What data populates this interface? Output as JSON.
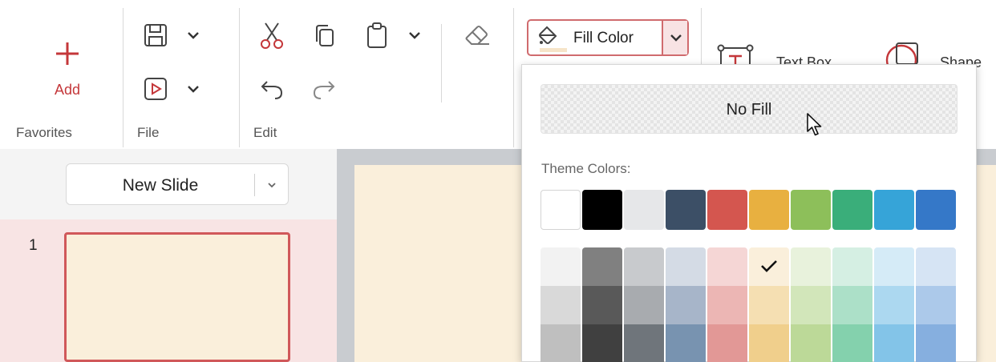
{
  "ribbon": {
    "add_label": "Add",
    "groups": {
      "favorites": "Favorites",
      "file": "File",
      "edit": "Edit"
    },
    "fill_color_label": "Fill Color",
    "text_box_label": "Text Box",
    "shape_label": "Shape"
  },
  "slides_panel": {
    "new_slide_label": "New Slide",
    "slide_number": "1"
  },
  "fill_dropdown": {
    "no_fill_label": "No Fill",
    "theme_colors_label": "Theme Colors:",
    "theme_colors": [
      "#ffffff",
      "#000000",
      "#e6e7e9",
      "#3c4f66",
      "#d4564f",
      "#e8b040",
      "#8dbf5a",
      "#3aae7a",
      "#36a4d8",
      "#3578c8"
    ],
    "shades": [
      [
        "#f2f2f2",
        "#d9d9d9",
        "#bfbfbf"
      ],
      [
        "#808080",
        "#595959",
        "#404040"
      ],
      [
        "#c8cacd",
        "#a8abaf",
        "#6f757b"
      ],
      [
        "#d4dbe5",
        "#a7b5c9",
        "#7893b0"
      ],
      [
        "#f5d6d5",
        "#ecb6b4",
        "#e29896"
      ],
      [
        "#faefdb",
        "#f5dfb2",
        "#f0cf8c"
      ],
      [
        "#e8f2dc",
        "#d2e6ba",
        "#bcd998"
      ],
      [
        "#d5efe3",
        "#ace0c8",
        "#84d1ad"
      ],
      [
        "#d5ebf7",
        "#acd8f0",
        "#83c4e8"
      ],
      [
        "#d6e4f4",
        "#acc9ea",
        "#86afdf"
      ]
    ],
    "selected_shade": "#faefdb"
  },
  "colors": {
    "accent": "#c4373a",
    "accent_border": "#d06b6e",
    "slide_bg": "#faefdb"
  }
}
